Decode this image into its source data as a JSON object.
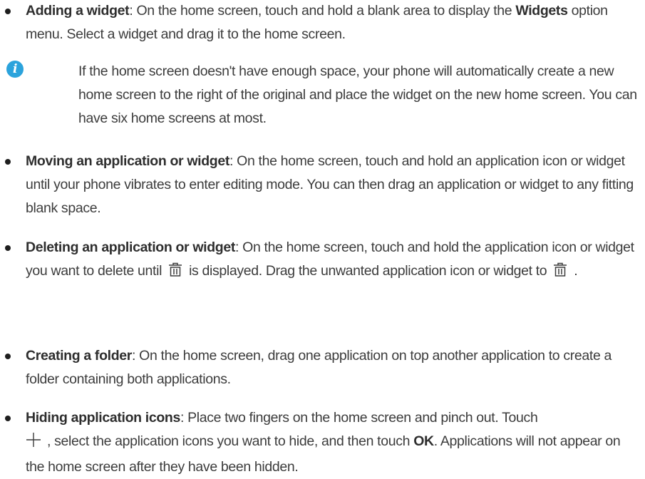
{
  "colors": {
    "note_icon": "#2ba3dc",
    "text": "#3c3c3c",
    "bullet": "#1e1e1e"
  },
  "icons": {
    "note": "info-icon",
    "delete": "trash-icon",
    "add": "plus-icon"
  },
  "items": [
    {
      "bold": "Adding a widget",
      "pre": ": On the home screen, touch and hold a blank area to display the ",
      "bold2": "Widgets",
      "post": " option menu. Select a widget and drag it to the home screen."
    },
    {
      "note": "If the home screen doesn't have enough space, your phone will automatically create a new home screen to the right of the original and place the widget on the new home screen. You can have six home screens at most."
    },
    {
      "bold": "Moving an application or widget",
      "text": ": On the home screen, touch and hold an application icon or widget until your phone vibrates to enter editing mode. You can then drag an application or widget to any fitting blank space."
    },
    {
      "bold": "Deleting an application or widget",
      "pre": ": On the home screen, touch and hold the application icon or widget you want to delete until",
      "mid": "is displayed. Drag the unwanted application icon or widget to",
      "post": "."
    },
    {
      "bold": "Creating a folder",
      "text": ": On the home screen, drag one application on top another application to create a folder containing both applications."
    },
    {
      "bold": "Hiding application icons",
      "pre": ": Place two fingers on the home screen and pinch out. Touch",
      "mid": ", select the application icons you want to hide, and then touch ",
      "bold2": "OK",
      "post": ". Applications will not appear on the home screen after they have been hidden."
    }
  ]
}
